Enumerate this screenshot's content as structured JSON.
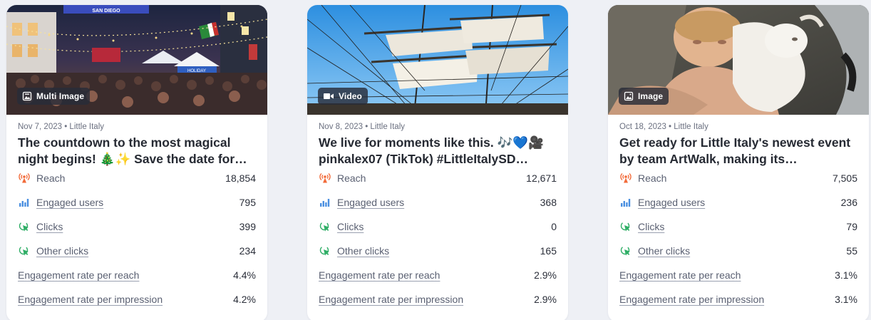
{
  "cards": [
    {
      "media_type_label": "Multi Image",
      "media_icon": "gallery-icon",
      "meta": "Nov 7, 2023 • Little Italy",
      "title": "The countdown to the most magical night begins! 🎄✨ Save the date for…",
      "reach_label": "Reach",
      "reach_value": "18,854",
      "engaged_label": "Engaged users",
      "engaged_value": "795",
      "clicks_label": "Clicks",
      "clicks_value": "399",
      "other_clicks_label": "Other clicks",
      "other_clicks_value": "234",
      "er_reach_label": "Engagement rate per reach",
      "er_reach_value": "4.4%",
      "er_impr_label": "Engagement rate per impression",
      "er_impr_value": "4.2%",
      "image_sign_text": "SAN DIEGO",
      "image_booth_text": "HOLIDAY"
    },
    {
      "media_type_label": "Video",
      "media_icon": "video-camera-icon",
      "meta": "Nov 8, 2023 • Little Italy",
      "title": "We live for moments like this. 🎶💙🎥 pinkalex07 (TikTok) #LittleItalySD…",
      "reach_label": "Reach",
      "reach_value": "12,671",
      "engaged_label": "Engaged users",
      "engaged_value": "368",
      "clicks_label": "Clicks",
      "clicks_value": "0",
      "other_clicks_label": "Other clicks",
      "other_clicks_value": "165",
      "er_reach_label": "Engagement rate per reach",
      "er_reach_value": "2.9%",
      "er_impr_label": "Engagement rate per impression",
      "er_impr_value": "2.9%"
    },
    {
      "media_type_label": "Image",
      "media_icon": "image-icon",
      "meta": "Oct 18, 2023 • Little Italy",
      "title": "Get ready for Little Italy's newest event by team ArtWalk, making its…",
      "reach_label": "Reach",
      "reach_value": "7,505",
      "engaged_label": "Engaged users",
      "engaged_value": "236",
      "clicks_label": "Clicks",
      "clicks_value": "79",
      "other_clicks_label": "Other clicks",
      "other_clicks_value": "55",
      "er_reach_label": "Engagement rate per reach",
      "er_reach_value": "3.1%",
      "er_impr_label": "Engagement rate per impression",
      "er_impr_value": "3.1%"
    }
  ],
  "colors": {
    "reach_icon": "#f26b3a",
    "engaged_icon": "#4a8fe0",
    "clicks_icon": "#2fae66",
    "background": "#eef0f5"
  }
}
